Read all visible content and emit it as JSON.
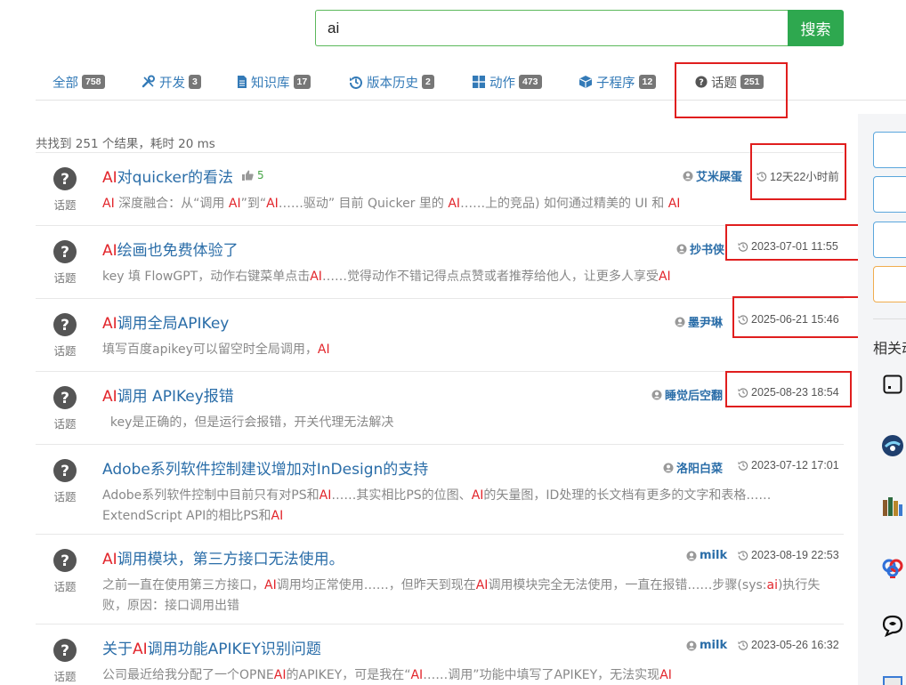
{
  "search": {
    "value": "ai",
    "button_label": "搜索"
  },
  "tabs": [
    {
      "label": "全部",
      "count": "758",
      "icon": "none"
    },
    {
      "label": "开发",
      "count": "3",
      "icon": "wrench-icon"
    },
    {
      "label": "知识库",
      "count": "17",
      "icon": "document-icon"
    },
    {
      "label": "版本历史",
      "count": "2",
      "icon": "history-icon"
    },
    {
      "label": "动作",
      "count": "473",
      "icon": "grid-icon"
    },
    {
      "label": "子程序",
      "count": "12",
      "icon": "cube-icon"
    },
    {
      "label": "话题",
      "count": "251",
      "icon": "question-circle-icon"
    }
  ],
  "summary": "共找到 251 个结果，耗时 20 ms",
  "results": [
    {
      "type": "话题",
      "title_hl": "AI",
      "title_rest": "对quicker的看法",
      "likes": "5",
      "author": "艾米屎蛋",
      "time": "12天22小时前",
      "snippet": [
        [
          "AI"
        ],
        " 深度融合：从“调用 ",
        [
          "AI"
        ],
        "”到“",
        [
          "AI"
        ],
        "……驱动” 目前 Quicker 里的 ",
        [
          "AI"
        ],
        "……上的竞品) 如何通过精美的 UI 和 ",
        [
          "AI"
        ]
      ]
    },
    {
      "type": "话题",
      "title_hl": "AI",
      "title_rest": "绘画也免费体验了",
      "likes": "",
      "author": "抄书侠",
      "time": "2023-07-01 11:55",
      "snippet": [
        "key 填 FlowGPT，动作右键菜单点击",
        [
          "AI"
        ],
        "……觉得动作不错记得点点赞或者推荐给他人，让更多人享受",
        [
          "AI"
        ]
      ]
    },
    {
      "type": "话题",
      "title_hl": "AI",
      "title_rest": "调用全局APIKey",
      "likes": "",
      "author": "墨尹琳",
      "time": "2025-06-21 15:46",
      "snippet": [
        "填写百度apikey可以留空时全局调用，",
        [
          "AI"
        ]
      ]
    },
    {
      "type": "话题",
      "title_hl": "AI",
      "title_rest": "调用 APIKey报错",
      "likes": "",
      "author": "睡觉后空翻",
      "time": "2025-08-23 18:54",
      "snippet": [
        "  key是正确的，但是运行会报错，开关代理无法解决"
      ]
    },
    {
      "type": "话题",
      "title_hl": "",
      "title_rest": "Adobe系列软件控制建议增加对InDesign的支持",
      "likes": "",
      "author": "洛阳白菜",
      "time": "2023-07-12 17:01",
      "snippet": [
        "Adobe系列软件控制中目前只有对PS和",
        [
          "AI"
        ],
        "……其实相比PS的位图、",
        [
          "AI"
        ],
        "的矢量图，ID处理的长文档有更多的文字和表格……ExtendScript API的相比PS和",
        [
          "AI"
        ]
      ]
    },
    {
      "type": "话题",
      "title_hl": "AI",
      "title_rest": "调用模块，第三方接口无法使用。",
      "likes": "",
      "author": "milk",
      "time": "2023-08-19 22:53",
      "snippet": [
        "之前一直在使用第三方接口，",
        [
          "AI"
        ],
        "调用均正常使用……，但昨天到现在",
        [
          "AI"
        ],
        "调用模块完全无法使用，一直在报错……步骤(sys:",
        [
          "ai"
        ],
        ")执行失败，原因：接口调用出错"
      ]
    },
    {
      "type": "话题",
      "title_pre": "关于",
      "title_hl": "AI",
      "title_rest": "调用功能APIKEY识别问题",
      "likes": "",
      "author": "milk",
      "time": "2023-05-26 16:32",
      "snippet": [
        "公司最近给我分配了一个OPNE",
        [
          "AI"
        ],
        "的APIKEY，可是我在“",
        [
          "AI"
        ],
        "……调用”功能中填写了APIKEY，无法实现",
        [
          "AI"
        ]
      ]
    }
  ],
  "sidebar": {
    "title": "相关动"
  },
  "colors": {
    "link": "#2a6da8",
    "highlight": "#e2252b",
    "search_button": "#2ea84f",
    "annotation": "#e01e1e"
  }
}
